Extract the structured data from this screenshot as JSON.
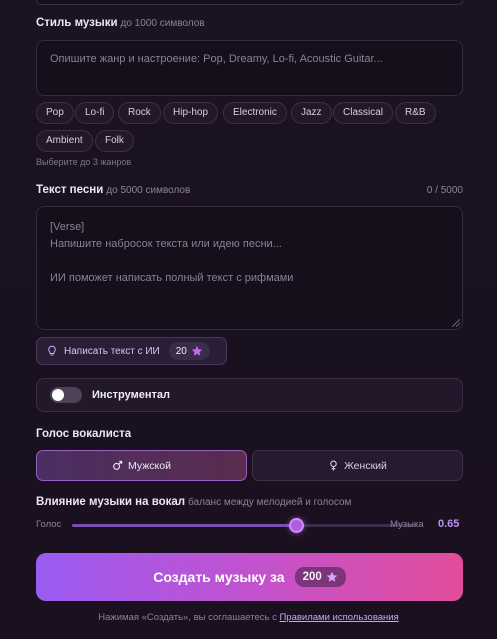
{
  "music_style": {
    "label": "Стиль музыки",
    "hint": "до 1000 символов",
    "placeholder": "Опишите жанр и настроение: Pop, Dreamy, Lo-fi, Acoustic Guitar...",
    "genres": [
      "Pop",
      "Lo-fi",
      "Rock",
      "Hip-hop",
      "Electronic",
      "Jazz",
      "Classical",
      "R&B",
      "Ambient",
      "Folk"
    ],
    "genres_hint": "Выберите до 3 жанров"
  },
  "lyrics": {
    "label": "Текст песни",
    "hint": "до 5000 символов",
    "counter": "0 / 5000",
    "placeholder_lines": [
      "[Verse]",
      "Напишите набросок текста или идею песни...",
      "",
      "ИИ поможет написать полный текст с рифмами"
    ]
  },
  "ai_write": {
    "label": "Написать текст с ИИ",
    "cost": "20",
    "icon": "lightbulb-icon"
  },
  "instrumental": {
    "label": "Инструментал",
    "enabled": false
  },
  "vocal": {
    "label": "Голос вокалиста",
    "options": [
      {
        "label": "Мужской",
        "icon": "male-icon",
        "selected": true
      },
      {
        "label": "Женский",
        "icon": "female-icon",
        "selected": false
      }
    ]
  },
  "influence": {
    "label": "Влияние музыки на вокал",
    "hint": "баланс между мелодией и голосом",
    "left_label": "Голос",
    "right_label": "Музыка",
    "value": "0.65",
    "fraction": 0.65
  },
  "create": {
    "label": "Создать музыку за",
    "cost": "200"
  },
  "terms": {
    "text": "Нажимая «Создать», вы соглашаетесь с",
    "link": "Правилами использования"
  },
  "colors": {
    "accent": "#b05ee0",
    "button_start": "#9a5cf2",
    "button_end": "#e24d99"
  }
}
